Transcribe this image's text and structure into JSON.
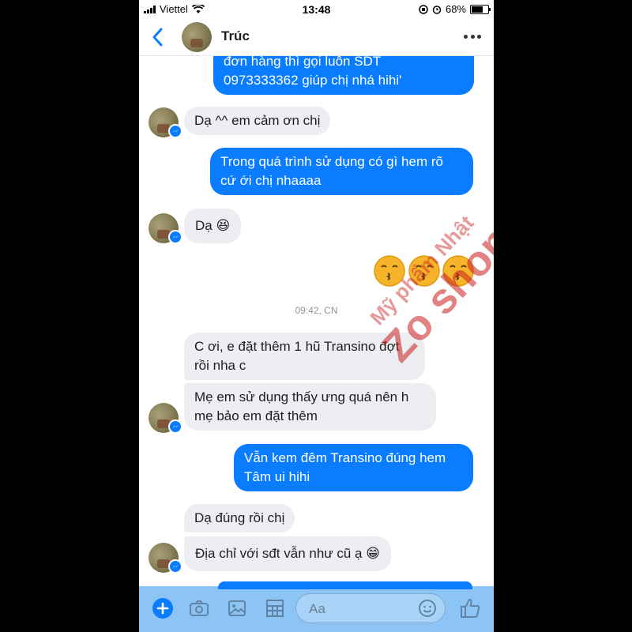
{
  "status_bar": {
    "carrier": "Viettel",
    "time": "13:48",
    "battery": "68%",
    "battery_level": 0.68
  },
  "header": {
    "contact_name": "Trúc"
  },
  "messages": {
    "m0": [
      "đơn hàng thì gọi luôn SDT",
      "0973333362 giúp chị nhá hihi'"
    ],
    "m1": "Dạ ^^ em cảm ơn chị",
    "m2": [
      "Trong quá trình sử dụng có gì hem rõ",
      "cứ ới chị nhaaaa"
    ],
    "m3": "Dạ 😆",
    "timestamp": "09:42, CN",
    "m4": [
      "C ơi, e đặt thêm 1 hũ Transino đợt",
      "rồi nha c"
    ],
    "m5": [
      "Mẹ em sử dụng thấy ưng quá nên h",
      "mẹ bảo em đặt thêm"
    ],
    "m6": [
      "Vẫn kem đêm Transino đúng hem",
      "Tâm ui hihi"
    ],
    "m7": "Dạ đúng rồi chị",
    "m8": "Địa chỉ với sđt vẫn như cũ ạ 😁"
  },
  "watermark": {
    "line1": "Mỹ phẩm Nhật",
    "line2": "Zo shop"
  },
  "composer": {
    "placeholder": "Aa"
  },
  "colors": {
    "accent": "#0a7cff",
    "incoming_bubble": "#eceef1",
    "composer_bg": "#8bc4f5"
  },
  "icons": [
    "back-arrow-icon",
    "more-options-icon",
    "plus-icon",
    "camera-icon",
    "photo-icon",
    "grid-icon",
    "smiley-icon",
    "thumbs-up-icon",
    "messenger-badge-icon",
    "kissing-emoji"
  ]
}
